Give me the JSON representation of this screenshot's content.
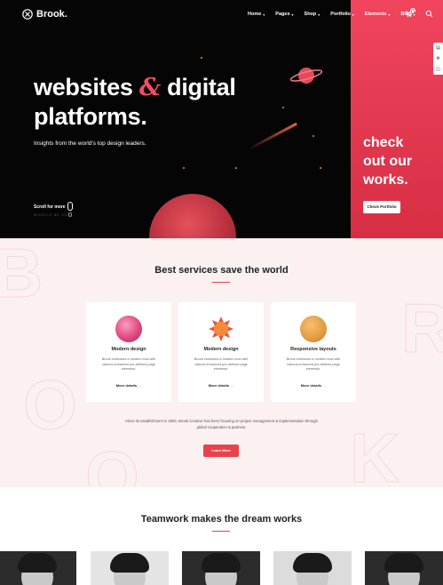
{
  "nav": {
    "logo": "Brook.",
    "menu": [
      "Home",
      "Pages",
      "Shop",
      "Portfolio",
      "Elements",
      "Blog"
    ],
    "cart_count": "0"
  },
  "hero": {
    "title_part1": "websites ",
    "title_amp": "&",
    "title_part2": " digital platforms.",
    "subtitle": "Insights from the world's top design leaders.",
    "scroll_label": "Scroll for more",
    "scroll_sub": "WHEELS BE SAFE",
    "cta_heading_lines": [
      "check",
      "out our",
      "works."
    ],
    "cta_button": "Check Portfolio"
  },
  "services": {
    "title": "Best services save the world",
    "cards": [
      {
        "title": "Modern design",
        "desc": "Brook embraces a modern look with various enhanced pre-defined page elements.",
        "link": "More details"
      },
      {
        "title": "Modern design",
        "desc": "Brook embraces a modern look with various enhanced pre-defined page elements.",
        "link": "More details"
      },
      {
        "title": "Responsive layouts",
        "desc": "Brook embraces a modern look with various enhanced pre-defined page elements.",
        "link": "More details"
      }
    ],
    "establishment_text": "Since its establishment in 2000, Brook Creative has been focusing on project management & implementation through global cooperation & partners.",
    "learn_button": "Learn More",
    "bg_letters": [
      "B",
      "R",
      "O",
      "O",
      "K"
    ]
  },
  "team": {
    "title": "Teamwork makes the dream works"
  },
  "colors": {
    "accent": "#e8434c",
    "hero_bg": "#050505",
    "cta_panel": "#f0455d",
    "services_bg": "#fcf1f1"
  }
}
